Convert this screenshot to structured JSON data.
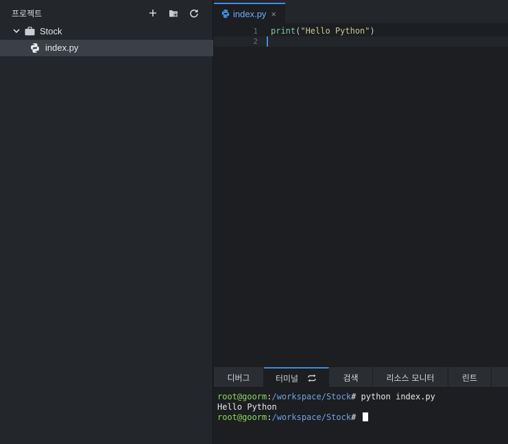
{
  "sidebar": {
    "title": "프로젝트",
    "tools": [
      {
        "icon": "plus-icon"
      },
      {
        "icon": "folder-settings-icon"
      },
      {
        "icon": "refresh-icon"
      }
    ],
    "tree": {
      "project": {
        "label": "Stock",
        "expanded": true,
        "icon": "briefcase-icon"
      },
      "files": [
        {
          "label": "index.py",
          "icon": "python-icon",
          "selected": true
        }
      ]
    }
  },
  "editor": {
    "tab": {
      "label": "index.py",
      "close": "×",
      "icon": "python-icon"
    },
    "lines": [
      {
        "num": "1",
        "fn": "print",
        "open": "(",
        "str": "\"Hello Python\"",
        "close": ")"
      },
      {
        "num": "2"
      }
    ]
  },
  "panel": {
    "tabs": [
      {
        "label": "디버그"
      },
      {
        "label": "터미널",
        "active": true,
        "icon": "sync-icon"
      },
      {
        "label": "검색"
      },
      {
        "label": "리소스 모니터"
      },
      {
        "label": "린트"
      }
    ],
    "terminal": {
      "lines": [
        {
          "user": "root@goorm",
          "sep": ":",
          "path": "/workspace/Stock",
          "cmd": "# python index.py"
        },
        {
          "output": "Hello Python"
        },
        {
          "user": "root@goorm",
          "sep": ":",
          "path": "/workspace/Stock",
          "cmd": "# "
        }
      ]
    }
  },
  "colors": {
    "accent": "#3d8fe8",
    "prompt_user": "#8bd85c",
    "prompt_path": "#6fa3e0"
  }
}
